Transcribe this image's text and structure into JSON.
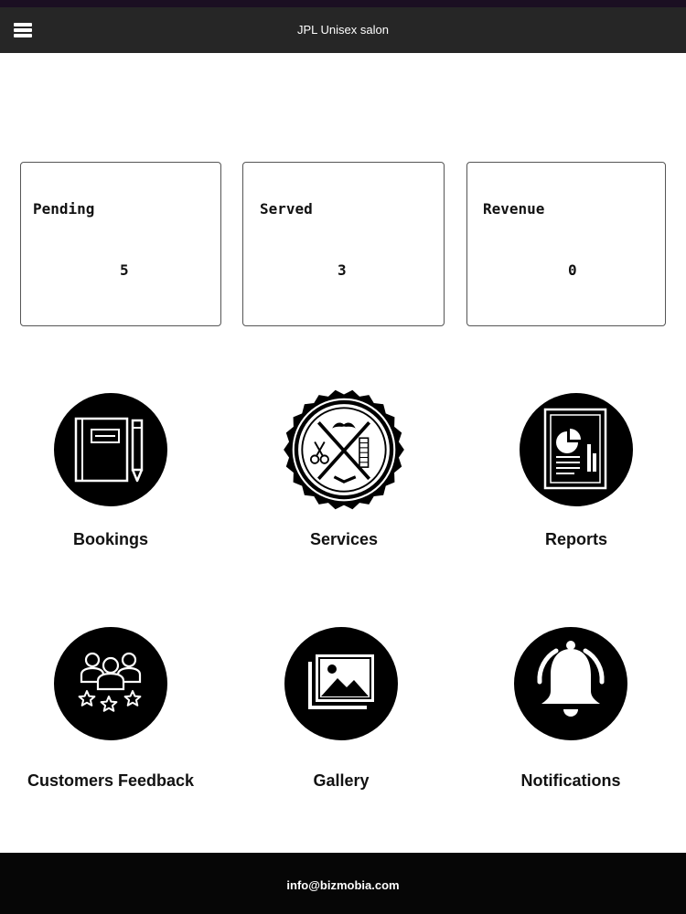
{
  "app": {
    "title": "JPL Unisex salon"
  },
  "stats": [
    {
      "label": "Pending",
      "value": "5"
    },
    {
      "label": "Served",
      "value": "3"
    },
    {
      "label": "Revenue",
      "value": "0"
    }
  ],
  "tiles": [
    {
      "label": "Bookings",
      "icon": "bookings-notebook-icon"
    },
    {
      "label": "Services",
      "icon": "barber-services-badge-icon"
    },
    {
      "label": "Reports",
      "icon": "report-document-icon"
    },
    {
      "label": "Customers Feedback",
      "icon": "customers-feedback-icon"
    },
    {
      "label": "Gallery",
      "icon": "gallery-image-icon"
    },
    {
      "label": "Notifications",
      "icon": "notification-bell-icon"
    }
  ],
  "footer": {
    "email": "info@bizmobia.com"
  },
  "colors": {
    "header_bg": "#262626",
    "footer_bg": "#060606",
    "icon_bg": "#000000"
  }
}
